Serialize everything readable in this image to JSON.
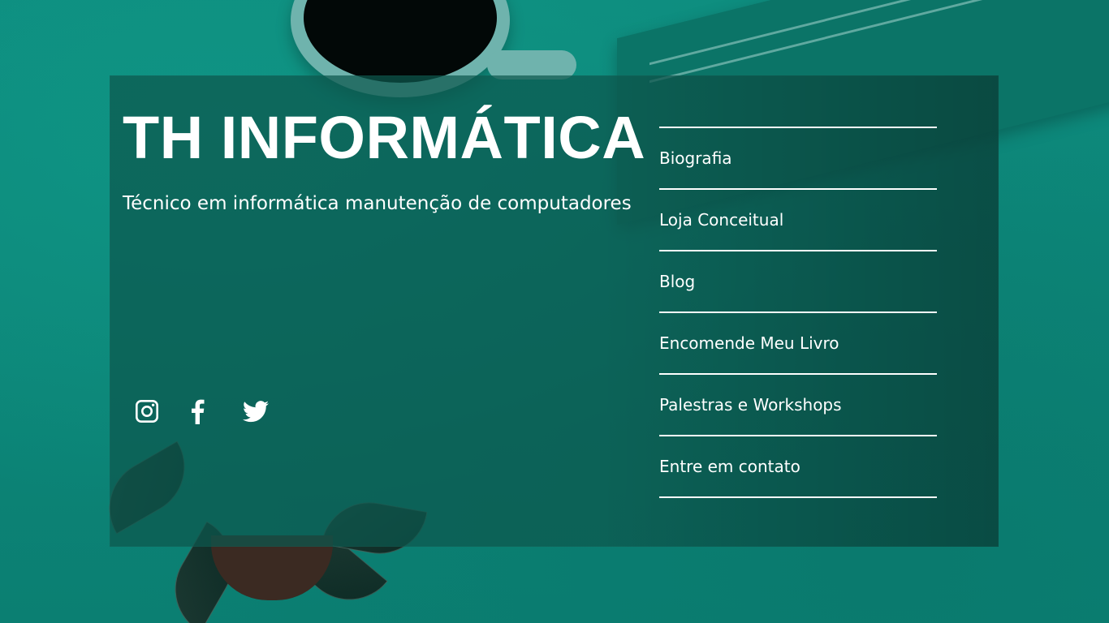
{
  "header": {
    "title": "TH INFORMÁTICA",
    "subtitle": "Técnico em informática manutenção de computadores"
  },
  "nav": {
    "items": [
      {
        "label": "Biografia"
      },
      {
        "label": "Loja Conceitual"
      },
      {
        "label": "Blog"
      },
      {
        "label": "Encomende Meu Livro"
      },
      {
        "label": "Palestras e Workshops"
      },
      {
        "label": "Entre em contato"
      }
    ]
  },
  "social": {
    "icons": [
      "instagram-icon",
      "facebook-icon",
      "twitter-icon"
    ]
  },
  "colors": {
    "background": "#0d8679",
    "panel": "#0c584e",
    "text": "#ffffff"
  }
}
